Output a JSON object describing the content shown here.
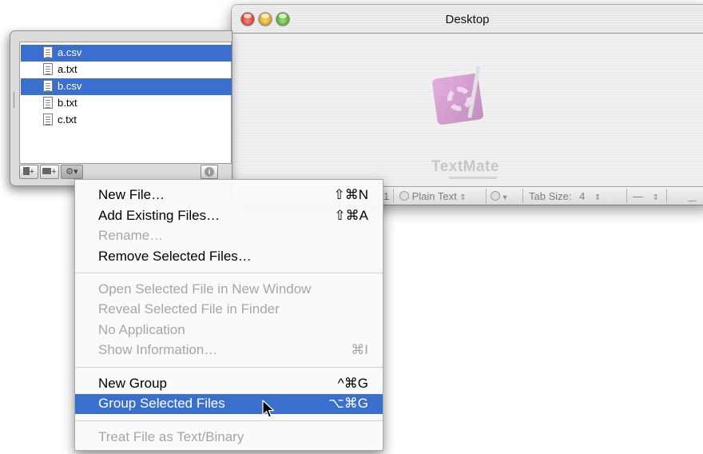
{
  "window": {
    "title": "Desktop",
    "app_logo_text": "TextMate",
    "status": {
      "line": "1",
      "language": "Plain Text",
      "tab_label": "Tab Size:",
      "tab_size": "4",
      "symbol": "—"
    }
  },
  "drawer": {
    "files": [
      {
        "name": "a.csv",
        "selected": true
      },
      {
        "name": "a.txt",
        "selected": false
      },
      {
        "name": "b.csv",
        "selected": true
      },
      {
        "name": "b.txt",
        "selected": false
      },
      {
        "name": "c.txt",
        "selected": false
      }
    ],
    "toolbar": {
      "new_file_icon": "new-file-icon",
      "new_folder_icon": "new-folder-icon",
      "action_icon": "gear-icon",
      "info_icon": "info-icon"
    }
  },
  "menu": {
    "items": [
      {
        "label": "New File…",
        "shortcut": "⇧⌘N",
        "enabled": true
      },
      {
        "label": "Add Existing Files…",
        "shortcut": "⇧⌘A",
        "enabled": true
      },
      {
        "label": "Rename…",
        "shortcut": "",
        "enabled": false
      },
      {
        "label": "Remove Selected Files…",
        "shortcut": "",
        "enabled": true
      },
      {
        "label": "Open Selected File in New Window",
        "shortcut": "",
        "enabled": false
      },
      {
        "label": "Reveal Selected File in Finder",
        "shortcut": "",
        "enabled": false
      },
      {
        "label": "No Application",
        "shortcut": "",
        "enabled": false
      },
      {
        "label": "Show Information…",
        "shortcut": "⌘I",
        "enabled": false
      },
      {
        "label": "New Group",
        "shortcut": "^⌘G",
        "enabled": true
      },
      {
        "label": "Group Selected Files",
        "shortcut": "⌥⌘G",
        "enabled": true,
        "highlighted": true
      },
      {
        "label": "Treat File as Text/Binary",
        "shortcut": "",
        "enabled": false
      }
    ]
  },
  "colors": {
    "selection": "#3a6fce",
    "disabled_text": "#a6a6a6"
  }
}
